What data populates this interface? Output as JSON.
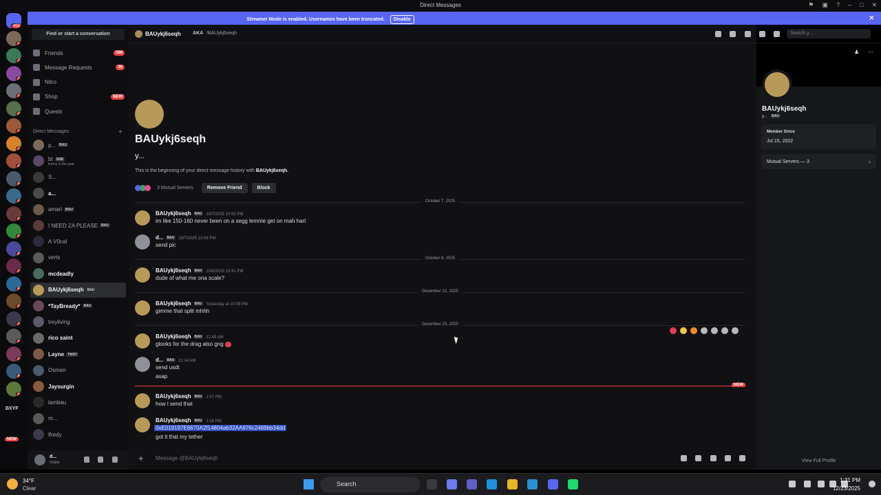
{
  "window": {
    "title": "Direct Messages"
  },
  "banner": {
    "message": "Streamer Mode is enabled. Usernames have been truncated.",
    "button": "Disable"
  },
  "guilds": [
    {
      "badge": "402"
    },
    {
      "badge": "1"
    },
    {
      "badge": "7"
    },
    {
      "badge": "2"
    },
    {
      "badge": "1"
    },
    {
      "badge": "2"
    },
    {
      "badge": "1"
    },
    {
      "badge": "1"
    },
    {
      "badge": "2"
    },
    {
      "badge": "3"
    },
    {
      "badge": "2"
    },
    {
      "badge": "2"
    },
    {
      "badge": "1"
    },
    {
      "badge": "5"
    },
    {
      "badge": "2"
    },
    {
      "badge": "5"
    },
    {
      "badge": "2"
    },
    {
      "badge": "3"
    },
    {
      "badge": "1"
    },
    {
      "badge": "2"
    },
    {
      "badge": "5"
    },
    {
      "badge": "1"
    }
  ],
  "guild_extra": {
    "label": "BXYF",
    "new_badge": "NEW"
  },
  "sidebar": {
    "find": "Find or start a conversation",
    "nav": [
      {
        "label": "Friends",
        "count": "366"
      },
      {
        "label": "Message Requests",
        "count": "36"
      },
      {
        "label": "Nitro",
        "count": ""
      },
      {
        "label": "Shop",
        "count": "NEW"
      },
      {
        "label": "Quests",
        "count": ""
      }
    ],
    "dm_header": "Direct Messages",
    "dms": [
      {
        "name": "p...",
        "tag": "BAU",
        "sub": "",
        "bold": false
      },
      {
        "name": "bt",
        "tag": "SSB",
        "sub": "konny is the goat",
        "bold": false
      },
      {
        "name": "S...",
        "tag": "",
        "sub": "",
        "bold": false
      },
      {
        "name": "a...",
        "tag": "",
        "sub": "",
        "bold": true
      },
      {
        "name": "amari",
        "tag": "BAU",
        "sub": "",
        "bold": false
      },
      {
        "name": "I NEED ZA PLEASE",
        "tag": "BAU",
        "sub": "",
        "bold": false
      },
      {
        "name": "A V0cal",
        "tag": "",
        "sub": "",
        "bold": false
      },
      {
        "name": "verts",
        "tag": "",
        "sub": "",
        "bold": false
      },
      {
        "name": "mcdeadly",
        "tag": "",
        "sub": "",
        "bold": true
      },
      {
        "name": "BAUykj6seqh",
        "tag": "BAU",
        "sub": "",
        "bold": false,
        "selected": true
      },
      {
        "name": "*TayBready*",
        "tag": "BAU",
        "sub": "",
        "bold": true
      },
      {
        "name": "treyliving",
        "tag": "",
        "sub": "",
        "bold": false
      },
      {
        "name": "rico saint",
        "tag": "",
        "sub": "",
        "bold": true
      },
      {
        "name": "Layne",
        "tag": "TWST",
        "sub": "",
        "bold": true
      },
      {
        "name": "Osmen",
        "tag": "",
        "sub": "",
        "bold": false
      },
      {
        "name": "Jaysurgin",
        "tag": "",
        "sub": "",
        "bold": true
      },
      {
        "name": "lambau",
        "tag": "",
        "sub": "",
        "bold": false
      },
      {
        "name": "m...",
        "tag": "",
        "sub": "",
        "bold": false
      },
      {
        "name": "lfredy",
        "tag": "",
        "sub": "",
        "bold": false
      }
    ]
  },
  "user": {
    "name": "d...",
    "status": "Online"
  },
  "header": {
    "name": "BAUykj6seqh",
    "aka": "AKA",
    "aka_value": "!BAUykj6seqh",
    "search": "Search y..."
  },
  "intro": {
    "name": "BAUykj6seqh",
    "username": "y...",
    "text": "This is the beginning of your direct message history with",
    "text_name": "BAUykj6seqh.",
    "mutual": "3 Mutual Servers",
    "remove": "Remove Friend",
    "block": "Block"
  },
  "dividers": [
    "October 7, 2025",
    "October 8, 2025",
    "December 22, 2025",
    "December 23, 2025"
  ],
  "messages": [
    {
      "author": "BAUykj6seqh",
      "tag": "BAU",
      "time": "10/7/2025 10:50 PM",
      "lines": [
        "im like 150-160 never been on a segg lemme get on mah hart"
      ]
    },
    {
      "author": "d...",
      "tag": "BAU",
      "time": "10/7/2025 10:56 PM",
      "lines": [
        "send pic"
      ]
    },
    {
      "author": "BAUykj6seqh",
      "tag": "BAU",
      "time": "10/8/2025 10:41 PM",
      "lines": [
        "dude of what me ona scale?"
      ]
    },
    {
      "author": "BAUykj6seqh",
      "tag": "BAU",
      "time": "Yesterday at 10:09 PM",
      "lines": [
        "gimme that split mhhh"
      ]
    },
    {
      "author": "BAUykj6seqh",
      "tag": "BAU",
      "time": "12:49 AM",
      "lines": [
        "glooks for the drag also gng"
      ]
    },
    {
      "author": "d...",
      "tag": "BAU",
      "time": "11:14 AM",
      "lines": [
        "send usdt",
        "asap"
      ]
    },
    {
      "author": "BAUykj6seqh",
      "tag": "BAU",
      "time": "1:07 PM",
      "lines": [
        "how i send that"
      ]
    },
    {
      "author": "BAUykj6seqh",
      "tag": "BAU",
      "time": "1:16 PM",
      "lines": [
        "0xE019197E6670A2f14804ab32AA976c2469bb34dd",
        "got it that my tether"
      ]
    }
  ],
  "new_label": "NEW",
  "composer": {
    "placeholder": "Message @BAUykj6seqh"
  },
  "profile": {
    "name": "BAUykj6seqh",
    "username": "y...",
    "tag": "BAU",
    "member_since_label": "Member Since",
    "member_since": "Jul 15, 2022",
    "mutual_servers": "Mutual Servers — 3",
    "view_full": "View Full Profile"
  },
  "taskbar": {
    "temp": "34°F",
    "condition": "Clear",
    "search": "Search",
    "time": "1:31 PM",
    "date": "12/23/2025"
  }
}
